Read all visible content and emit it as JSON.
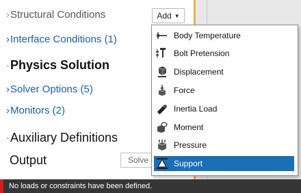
{
  "tree": {
    "structural_conditions": "Structural Conditions",
    "interface_conditions": "Interface Conditions (1)",
    "physics_solution": "Physics Solution",
    "solver_options": "Solver Options (5)",
    "monitors": "Monitors (2)",
    "auxiliary_definitions": "Auxiliary Definitions",
    "output": "Output"
  },
  "buttons": {
    "add_label": "Add",
    "solve_label": "Solve"
  },
  "menu": {
    "items": [
      {
        "label": "Body Temperature",
        "icon": "thermometer-icon"
      },
      {
        "label": "Bolt Pretension",
        "icon": "bolt-pretension-icon"
      },
      {
        "label": "Displacement",
        "icon": "displacement-icon"
      },
      {
        "label": "Force",
        "icon": "force-icon"
      },
      {
        "label": "Inertia Load",
        "icon": "inertia-load-icon"
      },
      {
        "label": "Moment",
        "icon": "moment-icon"
      },
      {
        "label": "Pressure",
        "icon": "pressure-icon"
      },
      {
        "label": "Support",
        "icon": "support-icon"
      }
    ],
    "selected": "Support"
  },
  "status": {
    "message": "No loads or constraints have been defined."
  },
  "colors": {
    "link": "#1a5fa8",
    "selection": "#1a6fb5",
    "panel_border": "#e2b34f",
    "status_bar": "#363636",
    "status_accent": "#d21f1f"
  }
}
